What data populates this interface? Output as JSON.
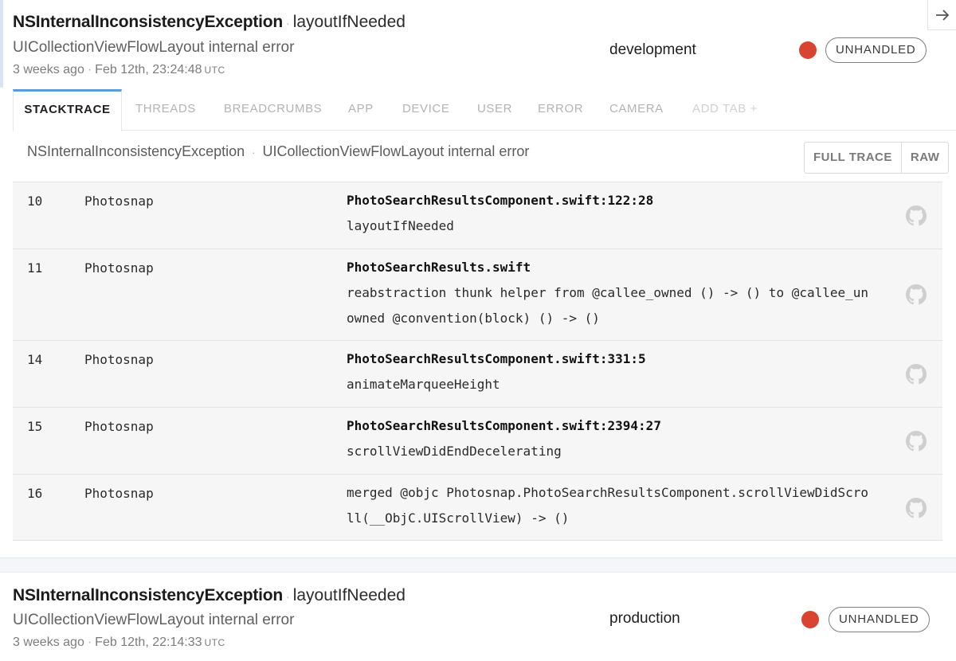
{
  "errors": [
    {
      "error_class": "NSInternalInconsistencyException",
      "context": "layoutIfNeeded",
      "message": "UICollectionViewFlowLayout internal error",
      "relative_time": "3 weeks ago",
      "timestamp": "Feb 12th, 23:24:48",
      "timezone": "UTC",
      "release_stage": "development",
      "status": "UNHANDLED",
      "severity_color": "#d94331"
    },
    {
      "error_class": "NSInternalInconsistencyException",
      "context": "layoutIfNeeded",
      "message": "UICollectionViewFlowLayout internal error",
      "relative_time": "3 weeks ago",
      "timestamp": "Feb 12th, 22:14:33",
      "timezone": "UTC",
      "release_stage": "production",
      "status": "UNHANDLED",
      "severity_color": "#d94331"
    }
  ],
  "collapse_icon": "arrow-right-icon",
  "tabs": [
    "STACKTRACE",
    "THREADS",
    "BREADCRUMBS",
    "APP",
    "DEVICE",
    "USER",
    "ERROR",
    "CAMERA",
    "ADD TAB +"
  ],
  "active_tab": "STACKTRACE",
  "trace": {
    "error_class": "NSInternalInconsistencyException",
    "message": "UICollectionViewFlowLayout internal error",
    "full_trace_label": "FULL TRACE",
    "raw_label": "RAW"
  },
  "frames": [
    {
      "number": "10",
      "module": "Photosnap",
      "file": "PhotoSearchResultsComponent.swift:122:28",
      "symbol": "layoutIfNeeded"
    },
    {
      "number": "11",
      "module": "Photosnap",
      "file": "PhotoSearchResults.swift",
      "symbol": "reabstraction thunk helper from @callee_owned () -> () to @callee_unowned @convention(block) () -> ()"
    },
    {
      "number": "14",
      "module": "Photosnap",
      "file": "PhotoSearchResultsComponent.swift:331:5",
      "symbol": "animateMarqueeHeight"
    },
    {
      "number": "15",
      "module": "Photosnap",
      "file": "PhotoSearchResultsComponent.swift:2394:27",
      "symbol": "scrollViewDidEndDecelerating"
    },
    {
      "number": "16",
      "module": "Photosnap",
      "file": "",
      "symbol": "merged @objc Photosnap.PhotoSearchResultsComponent.scrollViewDidScroll(__ObjC.UIScrollView) -> ()"
    }
  ],
  "frame_icon": "github-icon",
  "accent_color": "#5b9bd8"
}
